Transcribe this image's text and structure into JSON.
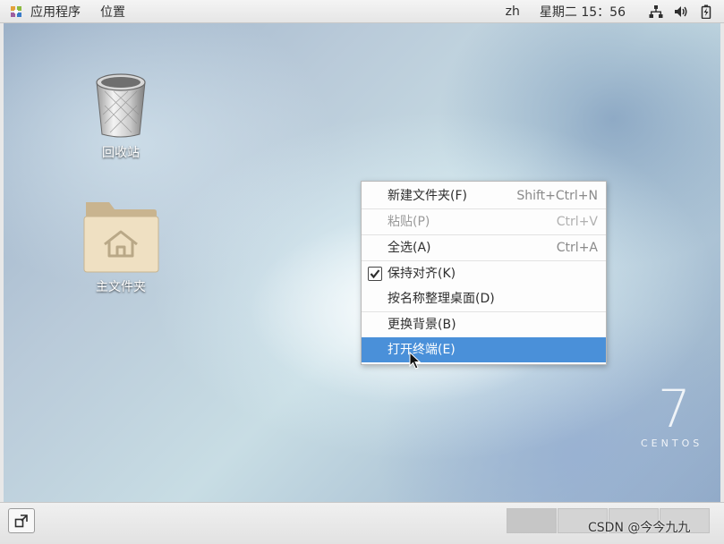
{
  "top_panel": {
    "apps_label": "应用程序",
    "places_label": "位置",
    "language": "zh",
    "clock": "星期二 15：56"
  },
  "desktop": {
    "icons": [
      {
        "label": "回收站",
        "icon": "trash-icon"
      },
      {
        "label": "主文件夹",
        "icon": "home-folder-icon"
      }
    ],
    "brand_number": "7",
    "brand_word": "CENTOS"
  },
  "context_menu": {
    "items": [
      {
        "label": "新建文件夹(F)",
        "shortcut": "Shift+Ctrl+N",
        "enabled": true
      },
      {
        "label": "粘贴(P)",
        "shortcut": "Ctrl+V",
        "enabled": false
      },
      {
        "label": "全选(A)",
        "shortcut": "Ctrl+A",
        "enabled": true
      },
      {
        "label": "保持对齐(K)",
        "checked": true,
        "enabled": true
      },
      {
        "label": "按名称整理桌面(D)",
        "enabled": true
      },
      {
        "label": "更换背景(B)",
        "enabled": true
      },
      {
        "label": "打开终端(E)",
        "enabled": true,
        "highlighted": true
      }
    ]
  },
  "bottom_panel": {
    "watermark": "CSDN @今今九九"
  },
  "colors": {
    "highlight": "#4a90d9",
    "panel": "#ececec"
  }
}
